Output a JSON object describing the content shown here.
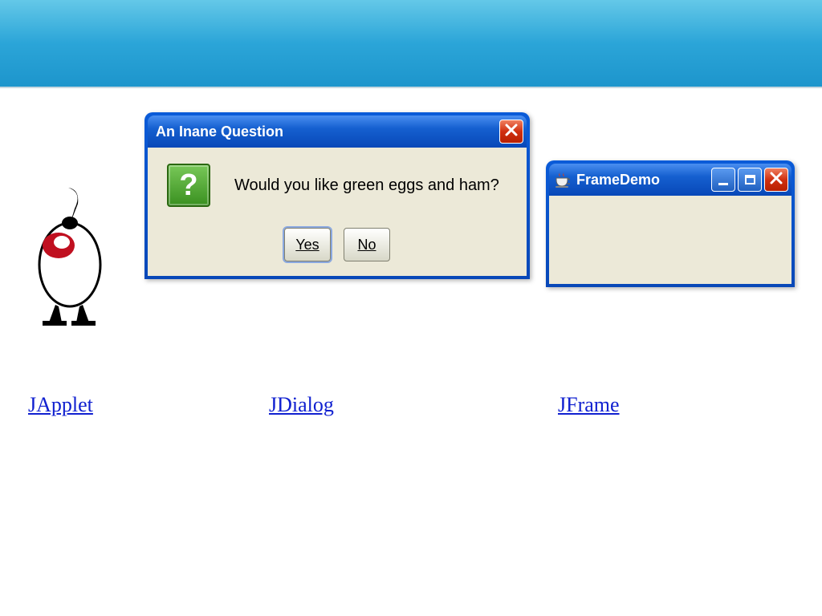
{
  "banner": {},
  "dialog": {
    "title": "An Inane Question",
    "message": "Would you like green eggs and ham?",
    "buttons": {
      "yes": "Yes",
      "no": "No"
    },
    "icon": "question-icon",
    "close": "✕"
  },
  "frame": {
    "title": "FrameDemo",
    "icon": "java-cup-icon"
  },
  "links": {
    "japplet": "JApplet",
    "jdialog": "JDialog",
    "jframe": "JFrame"
  }
}
